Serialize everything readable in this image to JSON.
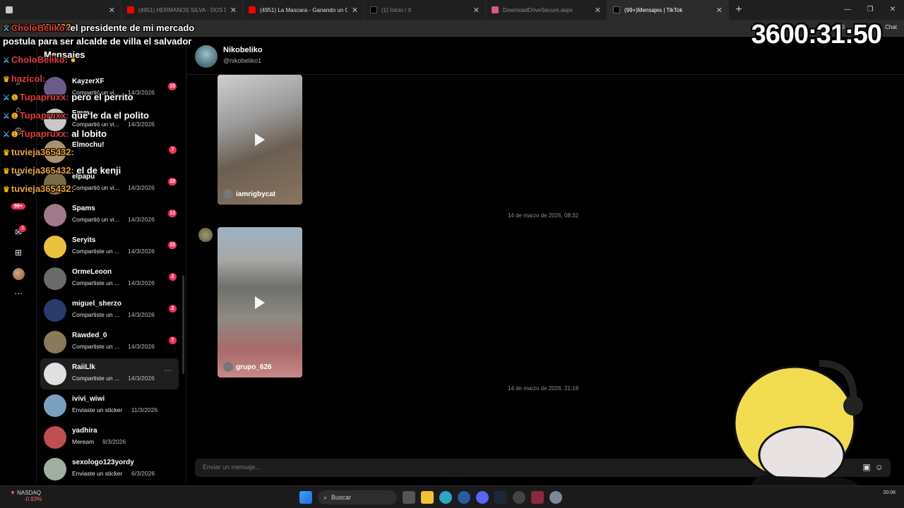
{
  "browser": {
    "tabs": [
      {
        "label": "",
        "active": false,
        "color": "#c8c8c8"
      },
      {
        "label": "(4951) HERMANOS SILVA - DOS D",
        "active": false,
        "color": "#ff0000"
      },
      {
        "label": "(4951) La Mascara - Ganando un C",
        "active": false,
        "color": "#ff0000"
      },
      {
        "label": "(1) Inicio / X",
        "active": false,
        "color": "#000000"
      },
      {
        "label": "DownloadDriveSecure.aspx",
        "active": false,
        "color": "#d45a8a"
      },
      {
        "label": "(99+)Mensajes | TikTok",
        "active": true,
        "color": "#000000"
      }
    ],
    "new_tab": "+",
    "chat_label": "Chat"
  },
  "stream": {
    "timer": "3600:31:50",
    "chat": [
      {
        "user": "tuvieja365432:",
        "text": "",
        "red": false
      },
      {
        "user": "CholoBeliko:",
        "text": "el presidente de mi mercado",
        "red": true
      },
      {
        "user": "",
        "text": "postula para ser alcalde de villa el salvador",
        "red": false
      },
      {
        "user": "CholoBeliko:",
        "text": "",
        "red": true
      },
      {
        "user": "hazicol:",
        "text": "",
        "red": true
      },
      {
        "user": "Tupapruxx:",
        "text": "pero el perrito",
        "red": true
      },
      {
        "user": "Tupapruxx:",
        "text": "que le da el polito",
        "red": true
      },
      {
        "user": "Tupapruxx:",
        "text": "al lobito",
        "red": true
      },
      {
        "user": "tuvieja365432:",
        "text": "",
        "red": false
      },
      {
        "user": "tuvieja365432:",
        "text": "el de kenji",
        "red": false
      },
      {
        "user": "tuvieja365432:",
        "text": "",
        "red": false
      }
    ]
  },
  "rail": {
    "badge": "99+",
    "inbox_count": "3"
  },
  "conversations": {
    "title": "Mensajes",
    "items": [
      {
        "name": "KayzerXF",
        "preview": "Compartió un vi...",
        "date": "14/3/2026",
        "count": "15",
        "avatar": "#6b5a8a"
      },
      {
        "name": "Emma...",
        "preview": "Compartió un vi...",
        "date": "14/3/2026",
        "count": "",
        "avatar": "#c8c8c8"
      },
      {
        "name": "Elmochu!",
        "preview": "",
        "date": "",
        "count": "7",
        "avatar": "#a89070"
      },
      {
        "name": "elpapu",
        "preview": "Compartió un vi...",
        "date": "14/3/2026",
        "count": "19",
        "avatar": "#7a6a4a"
      },
      {
        "name": "Spams",
        "preview": "Compartió un vi...",
        "date": "14/3/2026",
        "count": "13",
        "avatar": "#a07a8a"
      },
      {
        "name": "Seryits",
        "preview": "Compartiste un ...",
        "date": "14/3/2026",
        "count": "15",
        "avatar": "#e8c23a"
      },
      {
        "name": "OrmeLeoon",
        "preview": "Compartiste un ...",
        "date": "14/3/2026",
        "count": "2",
        "avatar": "#6a6a6a"
      },
      {
        "name": "miguel_sherzo",
        "preview": "Compartiste un ...",
        "date": "14/3/2026",
        "count": "2",
        "avatar": "#2a3a6a"
      },
      {
        "name": "Rawded_0",
        "preview": "Compartiste un ...",
        "date": "14/3/2026",
        "count": "7",
        "avatar": "#8a7a5a"
      },
      {
        "name": "RaiiLlk",
        "preview": "Compartiste un ...",
        "date": "14/3/2026",
        "count": "",
        "avatar": "#e0e0e0"
      },
      {
        "name": "ivivi_wiwi",
        "preview": "Enviaste un sticker",
        "date": "11/3/2026",
        "count": "",
        "avatar": "#7aa0c0"
      },
      {
        "name": "yadhira",
        "preview": "Meream",
        "date": "9/3/2026",
        "count": "",
        "avatar": "#c05050"
      },
      {
        "name": "sexologo123yordy",
        "preview": "Enviaste un sticker",
        "date": "6/3/2026",
        "count": "",
        "avatar": "#a0b0a0"
      }
    ]
  },
  "chat": {
    "name": "Nikobeliko",
    "handle": "@nikobeliko1",
    "video1_caption": "iamrigbycat",
    "timestamp1": "14 de marzo de 2026, 08:32",
    "video2_caption": "grupo_626",
    "timestamp2": "14 de marzo de 2026, 21:18",
    "composer_placeholder": "Enviar un mensaje..."
  },
  "taskbar": {
    "stock_name": "NASDAQ",
    "stock_change": "-0.93%",
    "search_label": "Buscar",
    "time": "20:06"
  }
}
